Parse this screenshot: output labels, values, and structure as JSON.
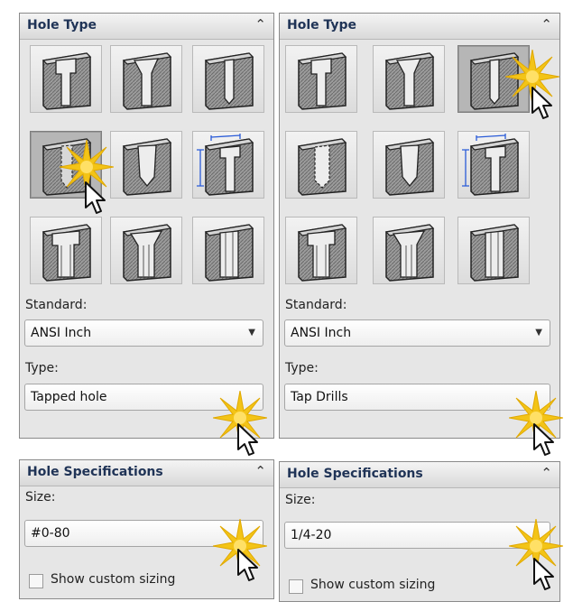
{
  "left": {
    "hole_type": {
      "title": "Hole Type",
      "selected_tile": "tapered-tap-hole"
    },
    "standard_label": "Standard:",
    "standard_value": "ANSI Inch",
    "type_label": "Type:",
    "type_value": "Tapped hole",
    "spec_title": "Hole Specifications",
    "size_label": "Size:",
    "size_value": "#0-80",
    "custom_sizing_label": "Show custom sizing"
  },
  "right": {
    "hole_type": {
      "title": "Hole Type",
      "selected_tile": "straight-tap-hole"
    },
    "standard_label": "Standard:",
    "standard_value": "ANSI Inch",
    "type_label": "Type:",
    "type_value": "Tap Drills",
    "spec_title": "Hole Specifications",
    "size_label": "Size:",
    "size_value": "1/4-20",
    "custom_sizing_label": "Show custom sizing"
  },
  "icons": {
    "collapse": "double-chevron-up-icon",
    "dropdown": "triangle-down-icon",
    "highlight": "starburst-icon",
    "pointer": "mouse-pointer-icon"
  },
  "colors": {
    "header_text": "#1f3356",
    "burst": "#f3c417",
    "panel_bg": "#e6e6e6"
  }
}
